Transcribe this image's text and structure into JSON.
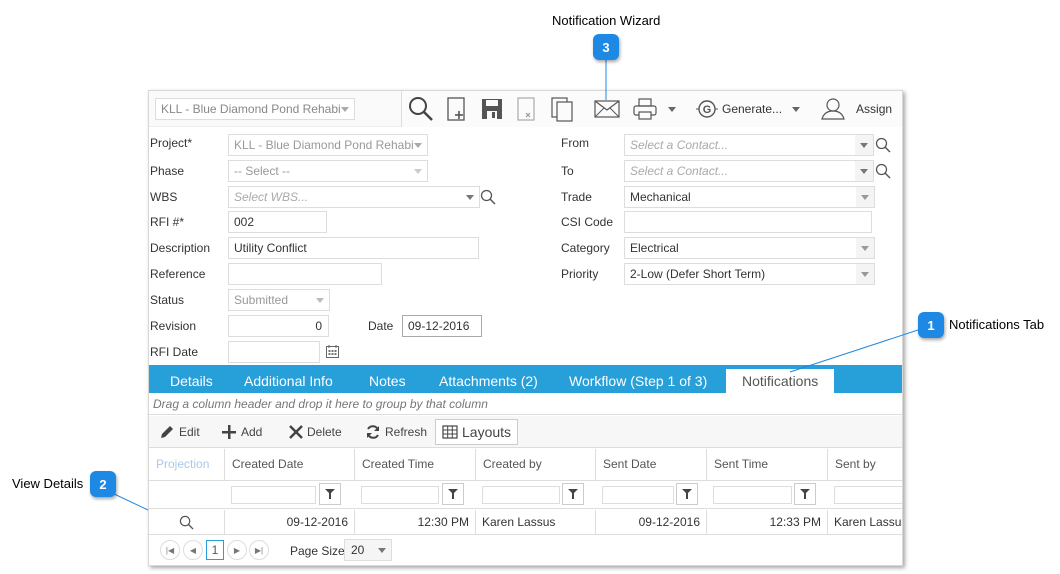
{
  "annotations": [
    {
      "number": "1",
      "label": "Notifications Tab"
    },
    {
      "number": "2",
      "label": "View Details"
    },
    {
      "number": "3",
      "label": "Notification Wizard"
    }
  ],
  "header": {
    "project_select": "KLL - Blue Diamond Pond Rehabi"
  },
  "toolbar": {
    "buttons": [
      {
        "name": "search",
        "icon": "search-icon"
      },
      {
        "name": "new",
        "icon": "new-document-icon"
      },
      {
        "name": "save",
        "icon": "save-icon"
      },
      {
        "name": "delete",
        "icon": "delete-document-icon"
      },
      {
        "name": "copy",
        "icon": "copy-icon"
      },
      {
        "name": "notification-wizard",
        "icon": "envelope-icon"
      },
      {
        "name": "print",
        "icon": "printer-icon"
      }
    ],
    "generate_label": "Generate...",
    "assign_label": "Assign"
  },
  "form": {
    "left": {
      "project": {
        "label": "Project*",
        "value": "KLL - Blue Diamond Pond Rehabi"
      },
      "phase": {
        "label": "Phase",
        "value": "-- Select --"
      },
      "wbs": {
        "label": "WBS",
        "placeholder": "Select WBS..."
      },
      "rfi_number": {
        "label": "RFI #*",
        "value": "002"
      },
      "description": {
        "label": "Description",
        "value": "Utility Conflict"
      },
      "reference": {
        "label": "Reference",
        "value": ""
      },
      "status": {
        "label": "Status",
        "value": "Submitted"
      },
      "revision": {
        "label": "Revision",
        "value": "0"
      },
      "date": {
        "label": "Date",
        "value": "09-12-2016"
      },
      "rfi_date": {
        "label": "RFI Date",
        "value": ""
      }
    },
    "right": {
      "from": {
        "label": "From",
        "placeholder": "Select a Contact..."
      },
      "to": {
        "label": "To",
        "placeholder": "Select a Contact..."
      },
      "trade": {
        "label": "Trade",
        "value": "Mechanical"
      },
      "csi_code": {
        "label": "CSI Code",
        "value": ""
      },
      "category": {
        "label": "Category",
        "value": "Electrical"
      },
      "priority": {
        "label": "Priority",
        "value": "2-Low (Defer Short Term)"
      }
    }
  },
  "tabs": [
    {
      "label": "Details",
      "active": false
    },
    {
      "label": "Additional Info",
      "active": false
    },
    {
      "label": "Notes",
      "active": false
    },
    {
      "label": "Attachments (2)",
      "active": false
    },
    {
      "label": "Workflow (Step 1 of 3)",
      "active": false
    },
    {
      "label": "Notifications",
      "active": true
    }
  ],
  "grid": {
    "group_hint": "Drag a column header and drop it here to group by that column",
    "toolbar": {
      "edit": "Edit",
      "add": "Add",
      "delete": "Delete",
      "refresh": "Refresh",
      "layouts": "Layouts"
    },
    "columns": [
      "Projection",
      "Created Date",
      "Created Time",
      "Created by",
      "Sent Date",
      "Sent Time",
      "Sent by"
    ],
    "rows": [
      {
        "created_date": "09-12-2016",
        "created_time": "12:30 PM",
        "created_by": "Karen Lassus",
        "sent_date": "09-12-2016",
        "sent_time": "12:33 PM",
        "sent_by": "Karen Lassus"
      }
    ],
    "pager": {
      "current_page": "1",
      "page_size_label": "Page Size",
      "page_size": "20"
    }
  },
  "colors": {
    "tab_bar": "#279fd8",
    "badge": "#1e88e5",
    "connector": "#1e88e5"
  }
}
